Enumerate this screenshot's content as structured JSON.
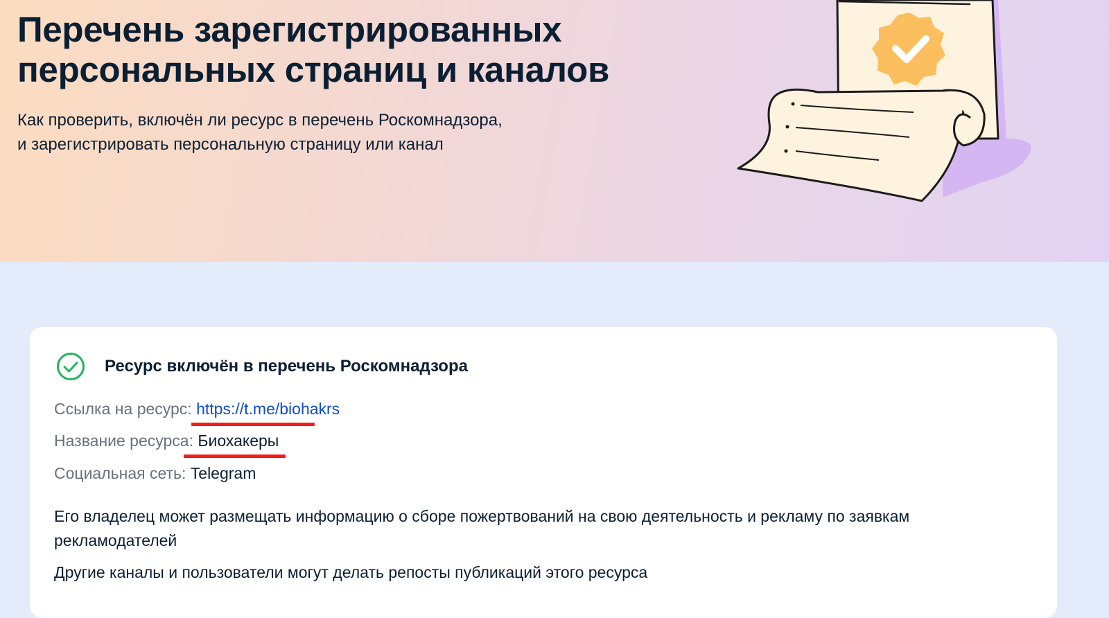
{
  "hero": {
    "title_line1": "Перечень зарегистрированных",
    "title_line2": "персональных страниц и каналов",
    "subtitle_line1": "Как проверить, включён ли ресурс в перечень Роскомнадзора,",
    "subtitle_line2": "и зарегистрировать персональную страницу или канал"
  },
  "result": {
    "status_title": "Ресурс включён в перечень Роскомнадзора",
    "link_label": "Ссылка на ресурс:",
    "link_value": "https://t.me/biohakrs",
    "name_label": "Название ресурса:",
    "name_value": "Биохакеры",
    "network_label": "Социальная сеть:",
    "network_value": "Telegram",
    "paragraph1": "Его владелец может размещать информацию о сборе пожертвований на свою деятельность и рекламу по заявкам рекламодателей",
    "paragraph2": "Другие каналы и пользователи могут делать репосты публикаций этого ресурса"
  },
  "icons": {
    "status": "check-circle-icon",
    "illustration": "document-scroll-badge-icon"
  },
  "colors": {
    "status_green": "#20b55a",
    "link_blue": "#0d4cd3",
    "highlight_red": "#f21d1d",
    "badge_orange": "#fbbf5f",
    "page_bg": "#e4ebfb"
  }
}
